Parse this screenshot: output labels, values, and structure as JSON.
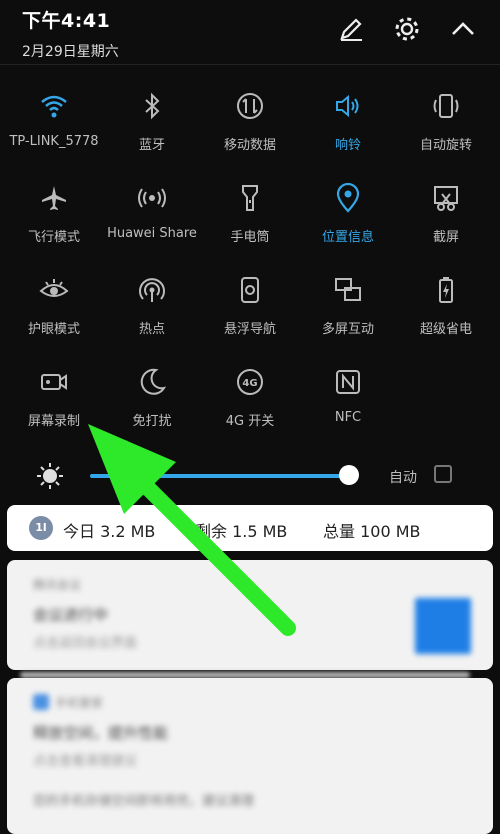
{
  "status": {
    "time": "下午4:41",
    "date": "2月29日星期六"
  },
  "header_icons": [
    "edit-icon",
    "settings-gear-icon",
    "collapse-chevron-icon"
  ],
  "accent": "#35a7e8",
  "tiles": [
    {
      "label": "TP-LINK_5778",
      "icon": "wifi-icon",
      "on": true
    },
    {
      "label": "蓝牙",
      "icon": "bluetooth-icon",
      "on": false
    },
    {
      "label": "移动数据",
      "icon": "mobile-data-icon",
      "on": false
    },
    {
      "label": "响铃",
      "icon": "sound-icon",
      "on": true
    },
    {
      "label": "自动旋转",
      "icon": "auto-rotate-icon",
      "on": false
    },
    {
      "label": "飞行模式",
      "icon": "airplane-icon",
      "on": false
    },
    {
      "label": "Huawei Share",
      "icon": "huawei-share-icon",
      "on": false
    },
    {
      "label": "手电筒",
      "icon": "flashlight-icon",
      "on": false
    },
    {
      "label": "位置信息",
      "icon": "location-icon",
      "on": true
    },
    {
      "label": "截屏",
      "icon": "screenshot-icon",
      "on": false
    },
    {
      "label": "护眼模式",
      "icon": "eye-comfort-icon",
      "on": false
    },
    {
      "label": "热点",
      "icon": "hotspot-icon",
      "on": false
    },
    {
      "label": "悬浮导航",
      "icon": "floating-nav-icon",
      "on": false
    },
    {
      "label": "多屏互动",
      "icon": "multi-screen-icon",
      "on": false
    },
    {
      "label": "超级省电",
      "icon": "ultra-power-saving-icon",
      "on": false
    },
    {
      "label": "屏幕录制",
      "icon": "screen-record-icon",
      "on": false
    },
    {
      "label": "免打扰",
      "icon": "do-not-disturb-icon",
      "on": false
    },
    {
      "label": "4G 开关",
      "icon": "4g-icon",
      "on": false
    },
    {
      "label": "NFC",
      "icon": "nfc-icon",
      "on": false
    }
  ],
  "brightness": {
    "auto_label": "自动",
    "level": 0.96,
    "auto_checked": false
  },
  "data_usage": {
    "icon_text": "1l",
    "today": "今日 3.2 MB",
    "remaining": "剩余 1.5 MB",
    "total": "总量 100 MB"
  },
  "notifications": [
    {
      "app": "腾讯会议",
      "title": "会议进行中",
      "subtitle": "点击返回会议界面"
    },
    {
      "app": "手机管家",
      "title": "释放空间，提升性能",
      "subtitle": "点击查看清理建议",
      "extra": "您的手机存储空间即将用完，建议清理"
    }
  ]
}
